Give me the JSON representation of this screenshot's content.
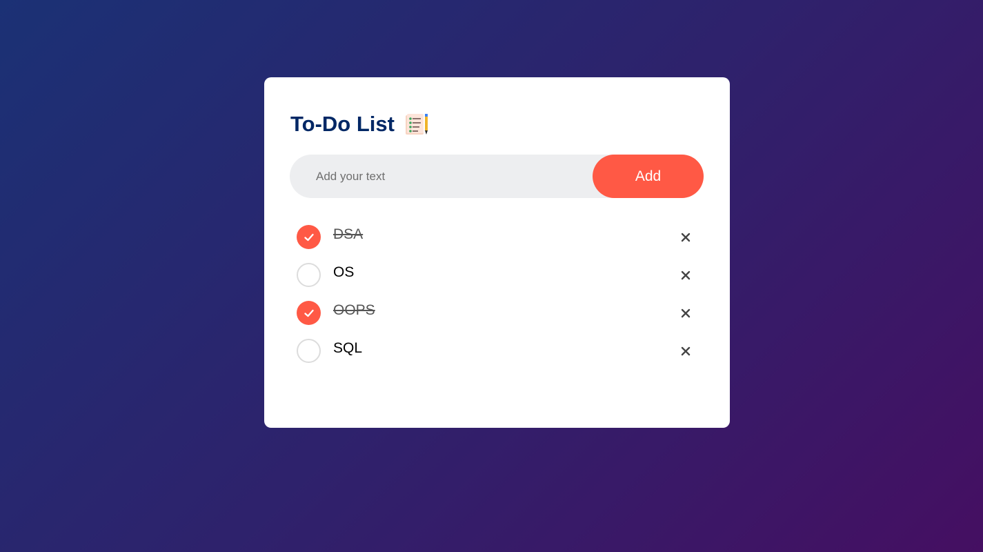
{
  "app": {
    "title": "To-Do List",
    "title_icon": "checklist-notepad-icon"
  },
  "input": {
    "placeholder": "Add your text",
    "value": ""
  },
  "add_button": {
    "label": "Add"
  },
  "colors": {
    "accent": "#ff5945",
    "title": "#002765",
    "input_bg": "#edeef0",
    "background_start": "#1b3175",
    "background_end": "#450f62"
  },
  "tasks": [
    {
      "label": "DSA",
      "checked": true,
      "remove_icon": "close-icon"
    },
    {
      "label": "OS",
      "checked": false,
      "remove_icon": "close-icon"
    },
    {
      "label": "OOPS",
      "checked": true,
      "remove_icon": "close-icon"
    },
    {
      "label": "SQL",
      "checked": false,
      "remove_icon": "close-icon"
    }
  ]
}
